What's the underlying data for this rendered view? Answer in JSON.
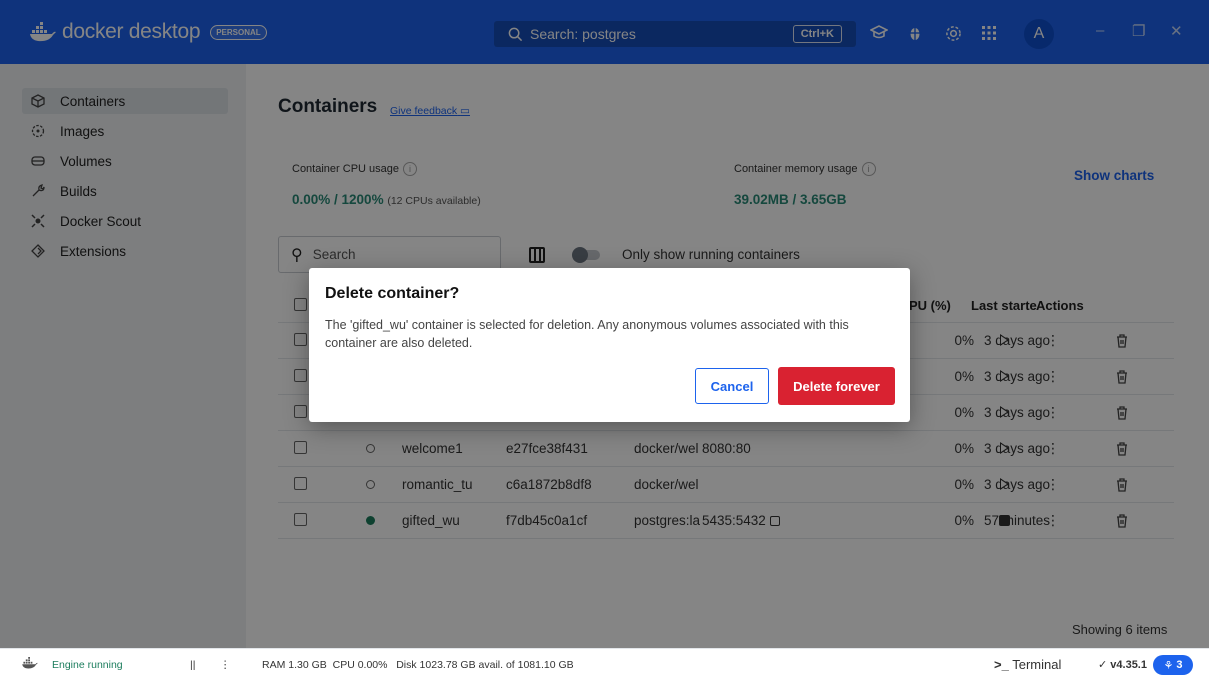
{
  "app": {
    "brand": "docker desktop",
    "plan_badge": "PERSONAL"
  },
  "topbar": {
    "search_text": "Search: postgres",
    "shortcut": "Ctrl+K",
    "avatar_initial": "A"
  },
  "sidebar": {
    "items": [
      {
        "label": "Containers",
        "icon": "containers-icon",
        "active": true
      },
      {
        "label": "Images",
        "icon": "images-icon"
      },
      {
        "label": "Volumes",
        "icon": "volumes-icon"
      },
      {
        "label": "Builds",
        "icon": "builds-icon"
      },
      {
        "label": "Docker Scout",
        "icon": "scout-icon"
      },
      {
        "label": "Extensions",
        "icon": "extensions-icon"
      }
    ]
  },
  "main": {
    "title": "Containers",
    "feedback_link": "Give feedback",
    "cpu": {
      "label": "Container CPU usage",
      "value": "0.00% / 1200%",
      "note": "(12 CPUs available)"
    },
    "memory": {
      "label": "Container memory usage",
      "value": "39.02MB / 3.65GB"
    },
    "show_charts": "Show charts",
    "search_placeholder": "Search",
    "running_toggle_label": "Only show running containers",
    "columns": {
      "cpu": "PU (%)",
      "last_started": "Last starte",
      "actions": "Actions"
    },
    "rows": [
      {
        "name": "",
        "id": "",
        "image": "",
        "port": "",
        "cpu": "0%",
        "last": "3 days ago",
        "running": false
      },
      {
        "name": "",
        "id": "",
        "image": "",
        "port": "",
        "cpu": "0%",
        "last": "3 days ago",
        "running": false
      },
      {
        "name": "",
        "id": "",
        "image": "",
        "port": "",
        "cpu": "0%",
        "last": "3 days ago",
        "running": false
      },
      {
        "name": "welcome1",
        "id": "e27fce38f431",
        "image": "docker/wel",
        "port": "8080:80",
        "cpu": "0%",
        "last": "3 days ago",
        "running": false
      },
      {
        "name": "romantic_tu",
        "id": "c6a1872b8df8",
        "image": "docker/wel",
        "port": "",
        "cpu": "0%",
        "last": "3 days ago",
        "running": false
      },
      {
        "name": "gifted_wu",
        "id": "f7db45c0a1cf",
        "image": "postgres:la",
        "port": "5435:5432",
        "cpu": "0%",
        "last": "57 minutes",
        "running": true
      }
    ],
    "showing": "Showing 6 items"
  },
  "modal": {
    "title": "Delete container?",
    "body": "The 'gifted_wu' container is selected for deletion. Any anonymous volumes associated with this container are also deleted.",
    "cancel": "Cancel",
    "confirm": "Delete forever"
  },
  "statusbar": {
    "engine": "Engine running",
    "resources": "RAM 1.30 GB  CPU 0.00%   Disk 1023.78 GB avail. of 1081.10 GB",
    "terminal": "Terminal",
    "version": "v4.35.1",
    "notifications": "3"
  },
  "colors": {
    "brand_blue": "#1d63ed",
    "danger_red": "#d92231",
    "running_green": "#1c7d5d"
  }
}
